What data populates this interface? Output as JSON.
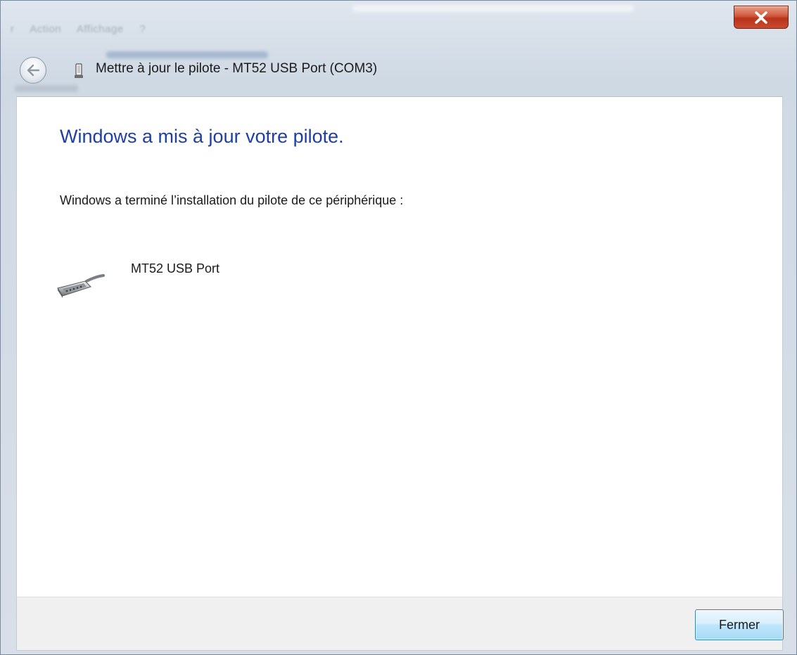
{
  "window": {
    "title": "Mettre à jour le pilote - MT52 USB Port (COM3)",
    "background_menu": [
      "r",
      "Action",
      "Affichage",
      "?"
    ]
  },
  "icons": {
    "close": "close-x-icon",
    "back": "back-arrow-icon",
    "title_device": "usb-device-icon",
    "device": "serial-port-connector-icon"
  },
  "content": {
    "heading": "Windows a mis à jour votre pilote.",
    "message": "Windows a terminé l’installation du pilote de ce périphérique :",
    "device_name": "MT52 USB Port"
  },
  "footer": {
    "close_label": "Fermer"
  },
  "colors": {
    "heading": "#1f3fa5",
    "close_button_red": "#c94a2e",
    "footer_bg": "#f0f0f0",
    "button_border": "#3c7fb1"
  }
}
